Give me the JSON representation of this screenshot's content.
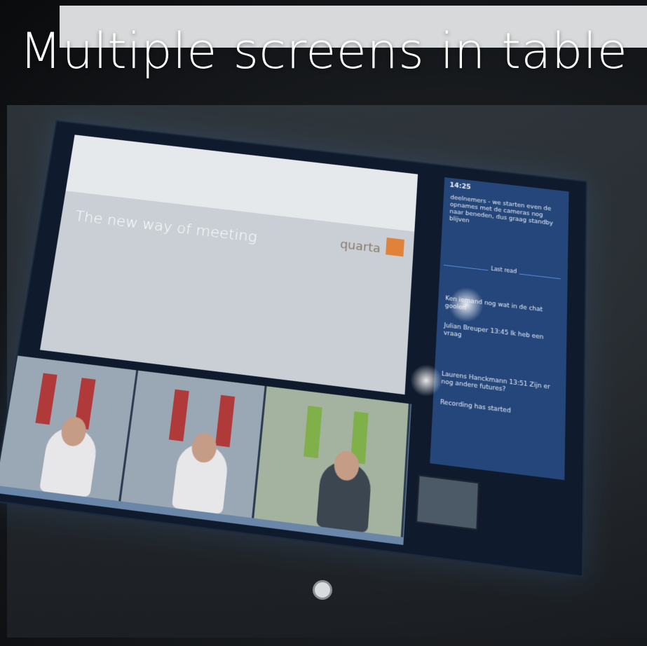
{
  "headline": "Multiple screens in table",
  "slide": {
    "title": "The new way of meeting",
    "brand": "quarta"
  },
  "chat": {
    "time": "14:25",
    "messages": [
      "deelnemers - we starten even de opnames met de cameras nog naar beneden, dus graag standby blijven",
      "Ken iemand nog wat in de chat goolen",
      "Julian Breuper 13:45 Ik heb een vraag",
      "Laurens Hanckmann 13:51 Zijn er nog andere futures?",
      "Recording has started"
    ],
    "divider_label": "Last read"
  },
  "colors": {
    "slide_bg": "#c9cfd5",
    "chat_bg": "#25467a",
    "brand_orange": "#e0823a"
  }
}
